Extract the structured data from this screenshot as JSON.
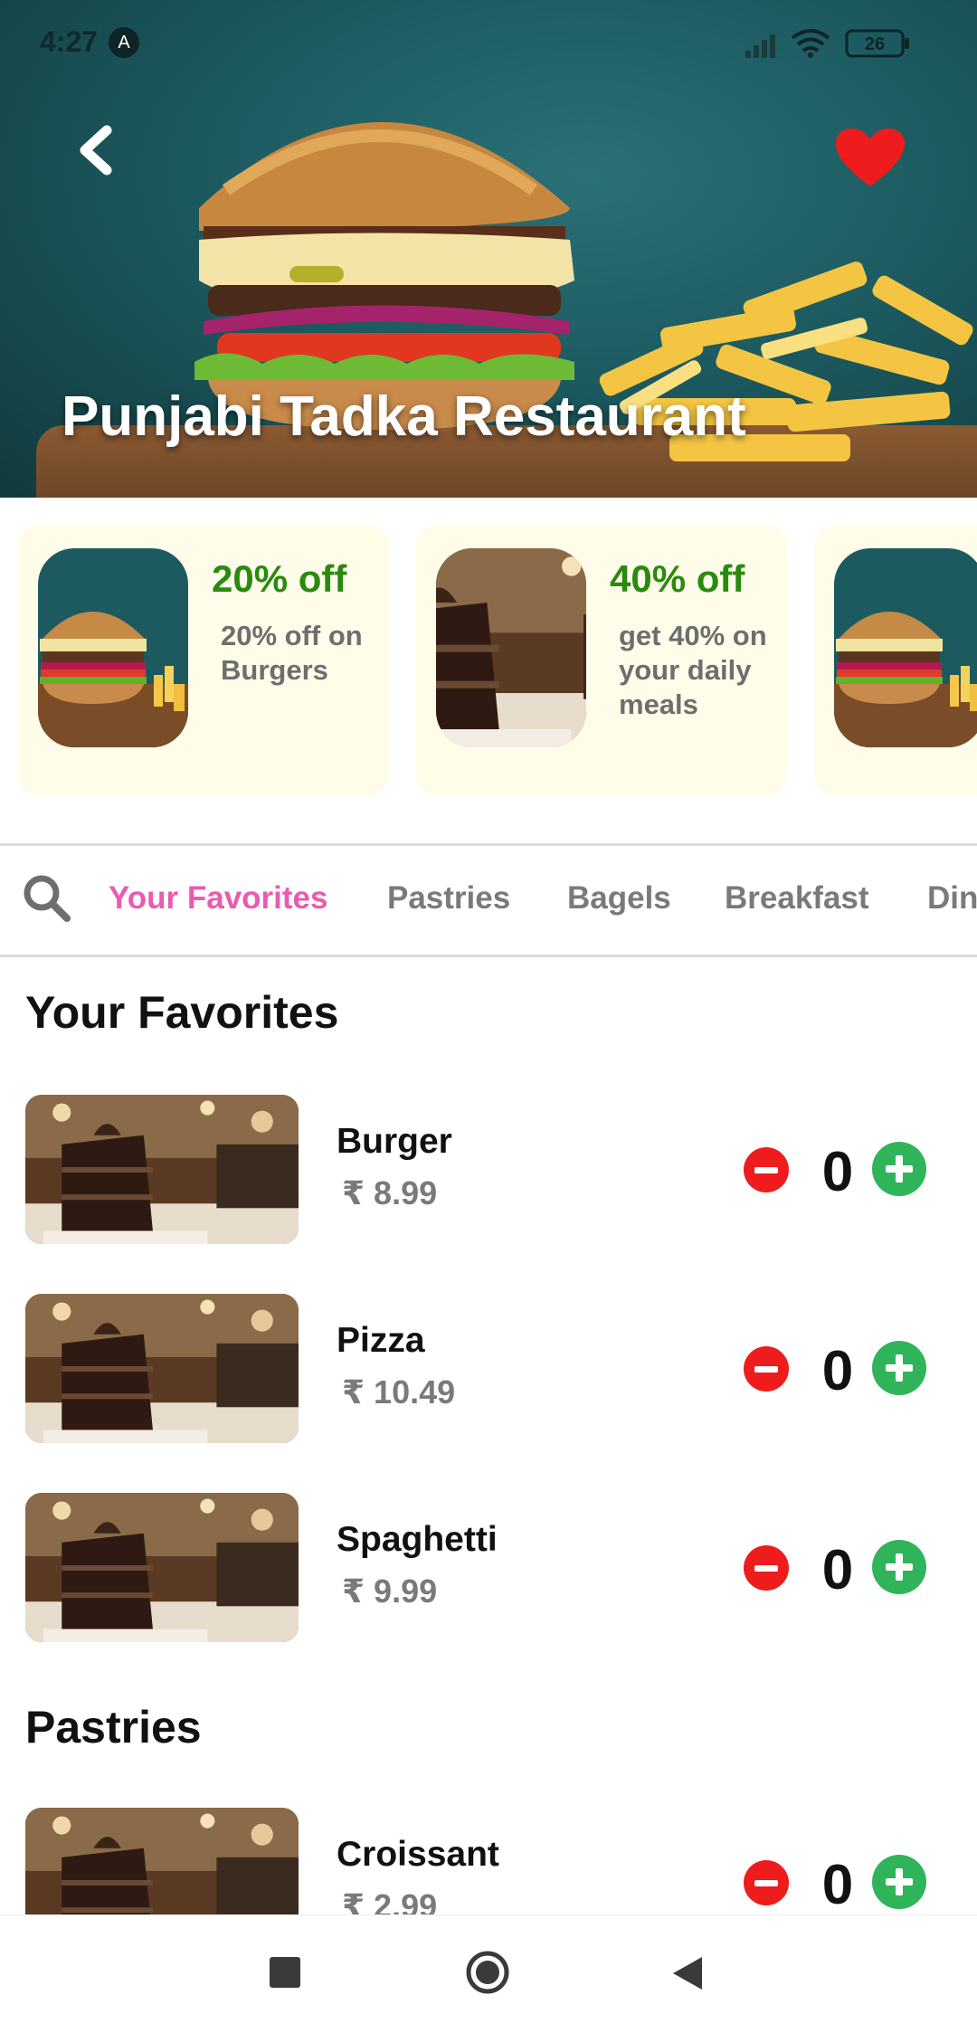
{
  "status_bar": {
    "time": "4:27",
    "badge": "A",
    "battery": "26"
  },
  "header": {
    "restaurant_name": "Punjabi Tadka Restaurant",
    "back_icon": "chevron-left-icon",
    "favorite_icon": "heart-icon",
    "favorite_color": "#ee1c1c"
  },
  "offers": [
    {
      "title": "20% off",
      "description": "20% off on Burgers",
      "image": "burger"
    },
    {
      "title": "40% off",
      "description": "get 40% on your daily meals",
      "image": "cake"
    },
    {
      "title": "",
      "description": "",
      "image": "burger"
    }
  ],
  "tabs": [
    {
      "label": "Your Favorites",
      "active": true
    },
    {
      "label": "Pastries",
      "active": false
    },
    {
      "label": "Bagels",
      "active": false
    },
    {
      "label": "Breakfast",
      "active": false
    },
    {
      "label": "Din",
      "active": false
    }
  ],
  "sections": [
    {
      "title": "Your Favorites",
      "items": [
        {
          "name": "Burger",
          "price": "₹ 8.99",
          "quantity": "0"
        },
        {
          "name": "Pizza",
          "price": "₹ 10.49",
          "quantity": "0"
        },
        {
          "name": "Spaghetti",
          "price": "₹ 9.99",
          "quantity": "0"
        }
      ]
    },
    {
      "title": "Pastries",
      "items": [
        {
          "name": "Croissant",
          "price": "₹ 2.99",
          "quantity": "0"
        }
      ]
    }
  ],
  "colors": {
    "active_tab": "#ea5bb0",
    "offer_title": "#2a8a0e",
    "minus": "#ee1c1c",
    "plus": "#2fb45a",
    "offer_bg": "#fffdea"
  }
}
